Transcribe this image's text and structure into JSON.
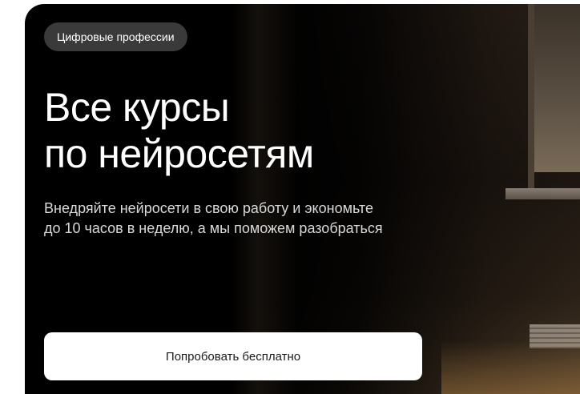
{
  "hero": {
    "badge": "Цифровые профессии",
    "title_line1": "Все курсы",
    "title_line2": "по нейросетям",
    "subtitle_line1": "Внедряйте нейросети в свою работу и экономьте",
    "subtitle_line2": "до 10 часов в неделю, а мы поможем разобраться",
    "cta_label": "Попробовать бесплатно"
  },
  "colors": {
    "hero_background": "#000000",
    "badge_background": "#3a3a3a",
    "cta_background": "#ffffff",
    "text_primary": "#ffffff"
  }
}
